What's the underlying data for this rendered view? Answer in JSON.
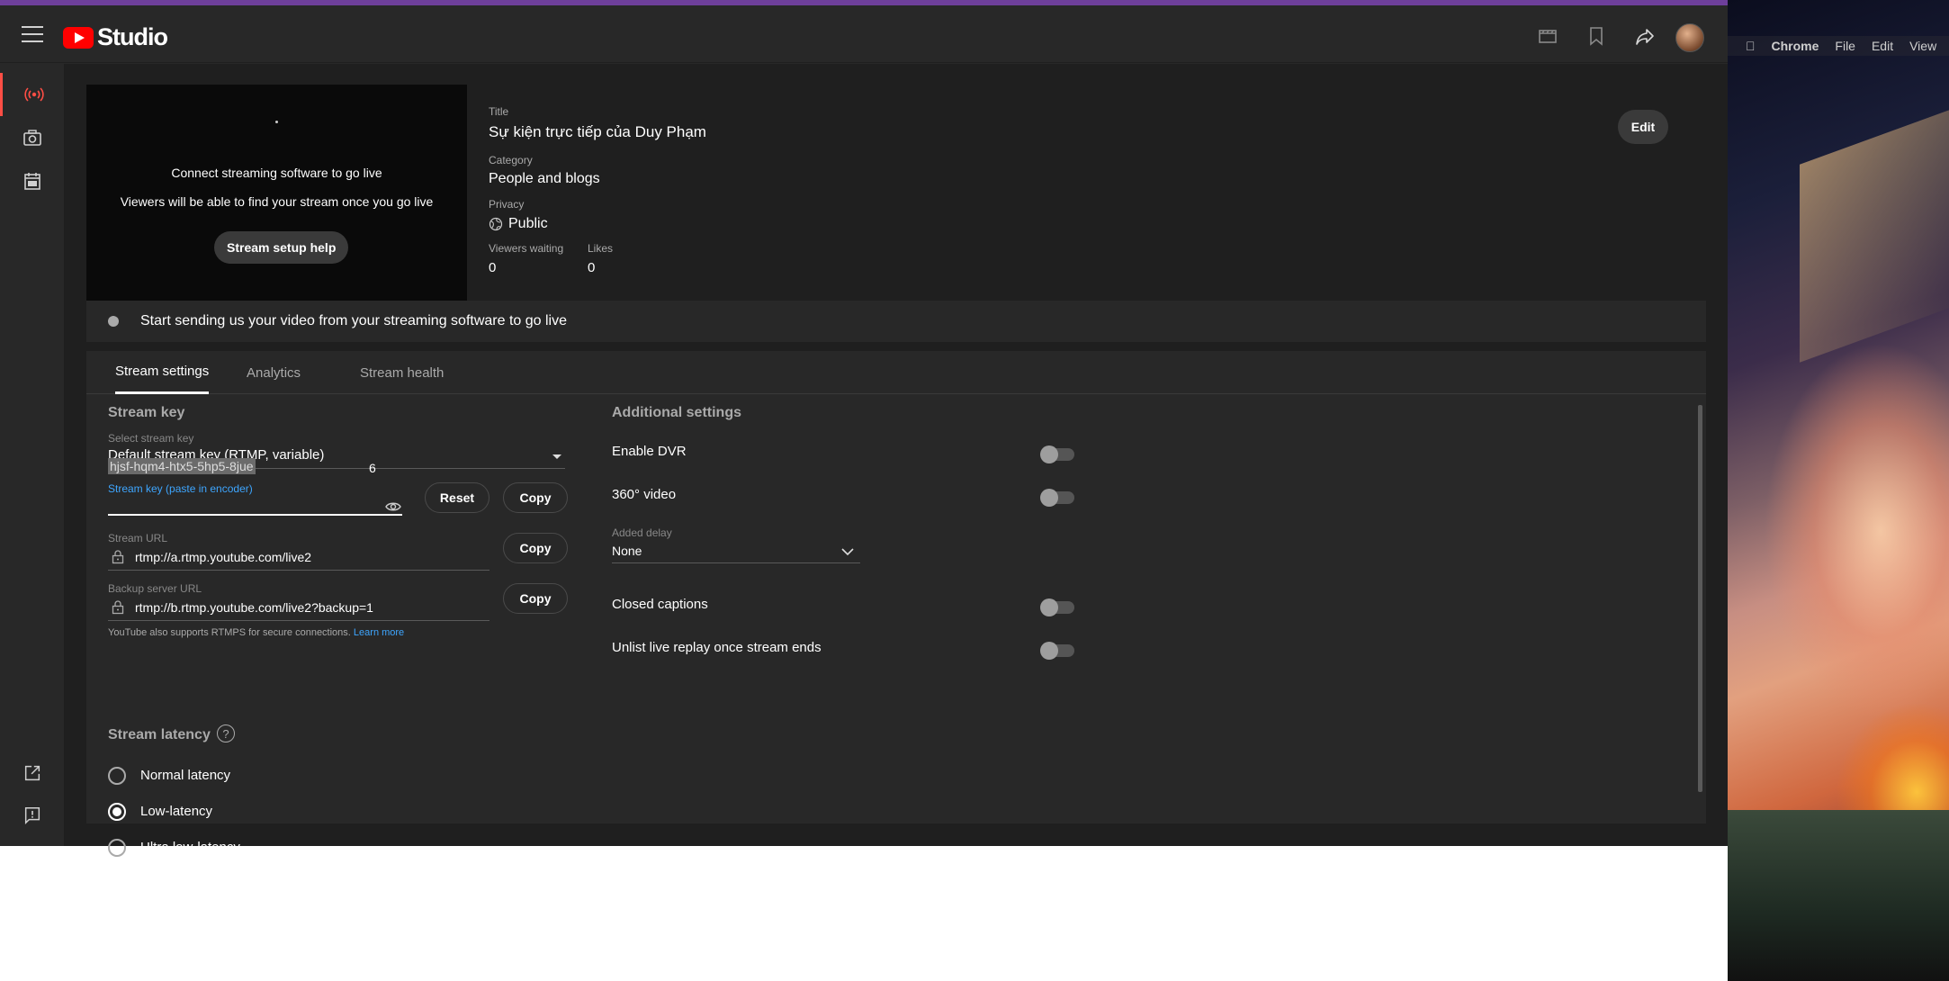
{
  "header": {
    "logo_text": "Studio"
  },
  "preview": {
    "line1": "Connect streaming software to go live",
    "line2": "Viewers will be able to find your stream once you go live",
    "help_button": "Stream setup help"
  },
  "info": {
    "title_label": "Title",
    "title_value": "Sự kiện trực tiếp của Duy Phạm",
    "category_label": "Category",
    "category_value": "People and blogs",
    "privacy_label": "Privacy",
    "privacy_value": "Public",
    "viewers_label": "Viewers waiting",
    "viewers_value": "0",
    "likes_label": "Likes",
    "likes_value": "0",
    "edit_button": "Edit"
  },
  "status": {
    "text": "Start sending us your video from your streaming software to go live"
  },
  "tabs": [
    {
      "label": "Stream settings",
      "active": true
    },
    {
      "label": "Analytics",
      "active": false
    },
    {
      "label": "Stream health",
      "active": false
    }
  ],
  "stream_key": {
    "section_title": "Stream key",
    "select_label": "Select stream key",
    "select_value": "Default stream key (RTMP, variable)",
    "key_label": "Stream key (paste in encoder)",
    "key_value": "hjsf-hqm4-htx5-5hp5-8jue",
    "key_suffix": "6",
    "reset_button": "Reset",
    "copy_button": "Copy",
    "url_label": "Stream URL",
    "url_value": "rtmp://a.rtmp.youtube.com/live2",
    "backup_label": "Backup server URL",
    "backup_value": "rtmp://b.rtmp.youtube.com/live2?backup=1",
    "rtmps_note": "YouTube also supports RTMPS for secure connections.",
    "learn_more": "Learn more"
  },
  "latency": {
    "section_title": "Stream latency",
    "options": [
      {
        "label": "Normal latency",
        "checked": false
      },
      {
        "label": "Low-latency",
        "checked": true
      },
      {
        "label": "Ultra low-latency",
        "checked": false
      }
    ]
  },
  "additional": {
    "section_title": "Additional settings",
    "dvr": "Enable DVR",
    "video360": "360° video",
    "delay_label": "Added delay",
    "delay_value": "None",
    "captions": "Closed captions",
    "unlist": "Unlist live replay once stream ends"
  },
  "mac_menu": {
    "app": "Chrome",
    "items": [
      "File",
      "Edit",
      "View"
    ]
  },
  "colors": {
    "accent_red": "#ff0000",
    "link_blue": "#3ea6ff",
    "top_stripe": "#6e3f9b"
  }
}
